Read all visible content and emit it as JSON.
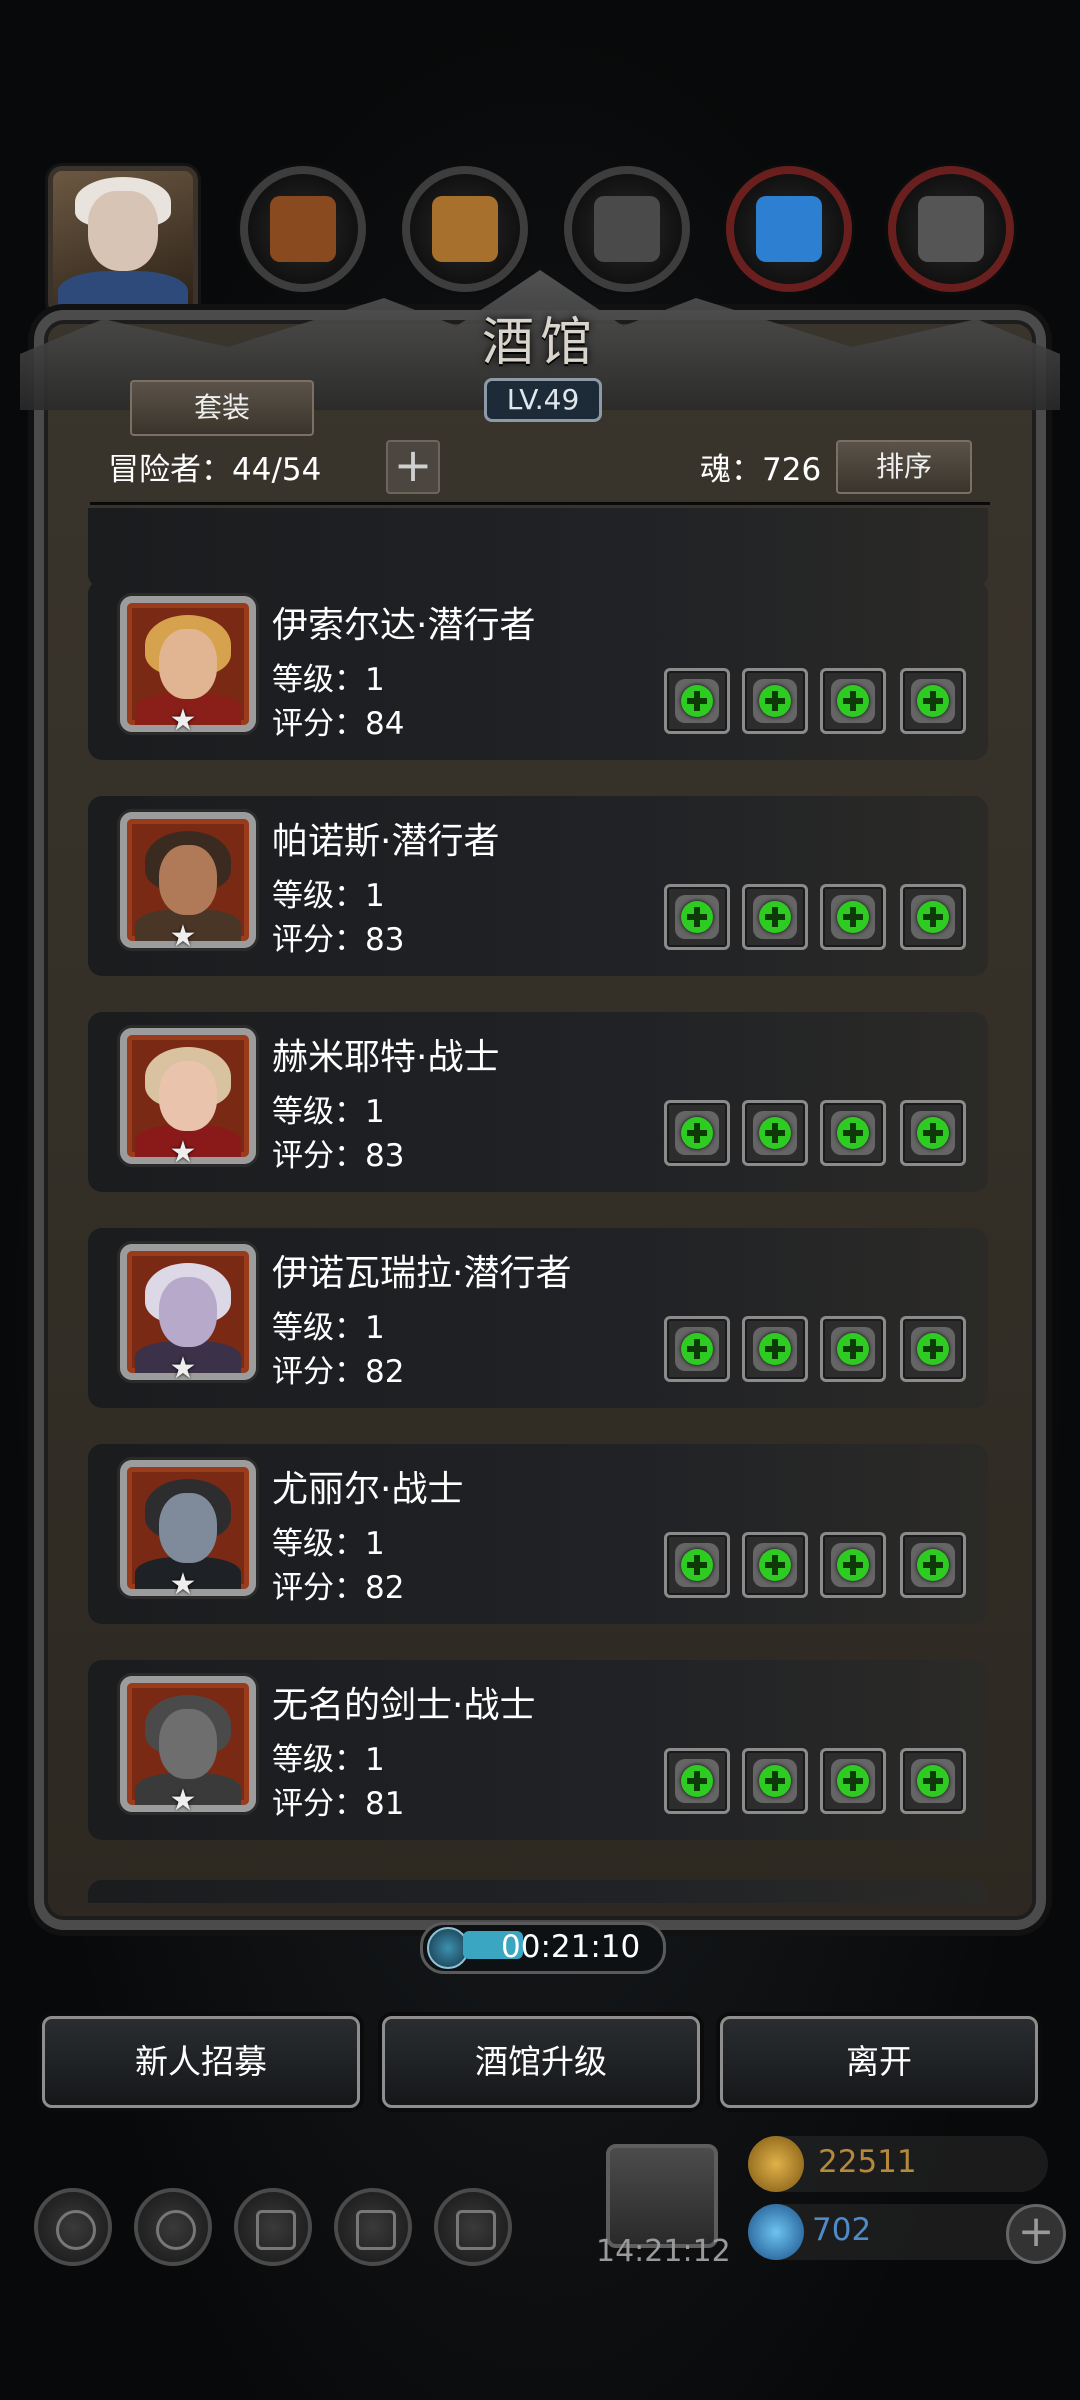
{
  "resources": [
    "",
    "",
    "",
    "",
    ""
  ],
  "panel": {
    "title": "酒馆",
    "level": "LV.49"
  },
  "toolbar": {
    "set_label": "套装",
    "adventurers_label": "冒险者：44/54",
    "add_symbol": "+",
    "soul_label": "魂：726",
    "sort_label": "排序"
  },
  "adventurers": [
    {
      "name": "伊索尔达·潜行者",
      "level": "等级：1",
      "score": "评分：84",
      "face": "#e2b592",
      "hair": "#d6a24d",
      "body": "#8a1f1a"
    },
    {
      "name": "帕诺斯·潜行者",
      "level": "等级：1",
      "score": "评分：83",
      "face": "#b07a58",
      "hair": "#3b2a1f",
      "body": "#4a3627"
    },
    {
      "name": "赫米耶特·战士",
      "level": "等级：1",
      "score": "评分：83",
      "face": "#eac3ad",
      "hair": "#d9c2a0",
      "body": "#8a1a1a"
    },
    {
      "name": "伊诺瓦瑞拉·潜行者",
      "level": "等级：1",
      "score": "评分：82",
      "face": "#b7a9c9",
      "hair": "#dcd8e6",
      "body": "#3b3148"
    },
    {
      "name": "尤丽尔·战士",
      "level": "等级：1",
      "score": "评分：82",
      "face": "#7f8a9a",
      "hair": "#2d2d2f",
      "body": "#1e2226"
    },
    {
      "name": "无名的剑士·战士",
      "level": "等级：1",
      "score": "评分：81",
      "face": "#6e6e6e",
      "hair": "#4a4a4a",
      "body": "#3a3a3a"
    }
  ],
  "timer": {
    "text": "00:21:10"
  },
  "buttons": {
    "recruit": "新人招募",
    "upgrade": "酒馆升级",
    "leave": "离开"
  },
  "footer": {
    "gift_time": "14:21:12",
    "coins": "22511",
    "gems": "702",
    "plus": "+"
  },
  "colors": {
    "accent_green": "#2ecb22",
    "panel_bg": "#3a352c",
    "card_bg": "#1a1c1e"
  }
}
